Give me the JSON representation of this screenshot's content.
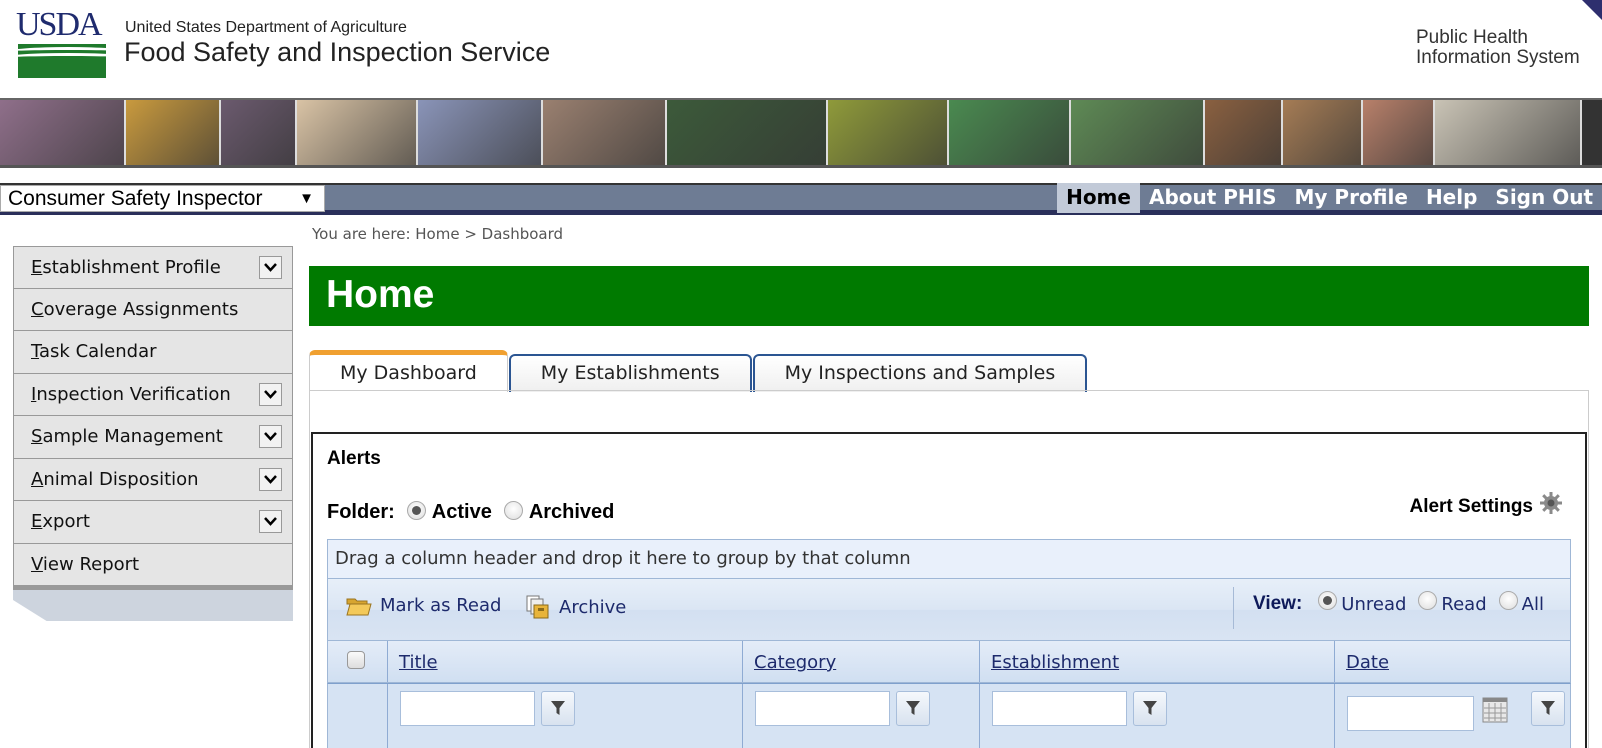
{
  "header": {
    "logo_text": "USDA",
    "agency_small": "United States Department of Agriculture",
    "agency_large": "Food Safety and Inspection Service",
    "system_name_line1": "Public Health",
    "system_name_line2": "Information System"
  },
  "photo_strip": {
    "photos": [
      {
        "subject": "lab-scientists",
        "color": "#8f6f8a"
      },
      {
        "subject": "chicks",
        "color": "#c99a3e"
      },
      {
        "subject": "poultry-processing",
        "color": "#6b5a6e"
      },
      {
        "subject": "pigs",
        "color": "#d9c3a5"
      },
      {
        "subject": "inspectors-lab",
        "color": "#8a94b8"
      },
      {
        "subject": "meat-processing-line",
        "color": "#9a8070"
      },
      {
        "subject": "cattle",
        "color": "#3c5a3a"
      },
      {
        "subject": "farmer-field",
        "color": "#8f9a3a"
      },
      {
        "subject": "microscope",
        "color": "#4a8a50"
      },
      {
        "subject": "crop-field",
        "color": "#5e8a55"
      },
      {
        "subject": "roast-poultry",
        "color": "#8a6040"
      },
      {
        "subject": "eggs",
        "color": "#a57c55"
      },
      {
        "subject": "food-worker",
        "color": "#b8806a"
      },
      {
        "subject": "cow-face",
        "color": "#c9c3b5"
      }
    ]
  },
  "navbar": {
    "role_select_value": "Consumer Safety Inspector",
    "links": [
      {
        "label": "Home",
        "active": true
      },
      {
        "label": "About PHIS",
        "active": false
      },
      {
        "label": "My Profile",
        "active": false
      },
      {
        "label": "Help",
        "active": false
      },
      {
        "label": "Sign Out",
        "active": false
      }
    ]
  },
  "sidebar": {
    "items": [
      {
        "accel": "E",
        "rest": "stablishment Profile",
        "expandable": true
      },
      {
        "accel": "C",
        "rest": "overage Assignments",
        "expandable": false
      },
      {
        "accel": "T",
        "rest": "ask Calendar",
        "expandable": false
      },
      {
        "accel": "I",
        "rest": "nspection Verification",
        "expandable": true
      },
      {
        "accel": "S",
        "rest": "ample Management",
        "expandable": true
      },
      {
        "accel": "A",
        "rest": "nimal Disposition",
        "expandable": true
      },
      {
        "accel": "E",
        "rest": "xport",
        "expandable": true
      },
      {
        "accel": "V",
        "rest": "iew Report",
        "expandable": false
      }
    ]
  },
  "breadcrumb": "You are here: Home > Dashboard",
  "page_title": "Home",
  "tabs": [
    {
      "label": "My Dashboard",
      "active": true
    },
    {
      "label": "My Establishments",
      "active": false
    },
    {
      "label": "My Inspections and Samples",
      "active": false
    }
  ],
  "alerts": {
    "title": "Alerts",
    "folder_label": "Folder:",
    "folder_options": [
      {
        "label": "Active",
        "checked": true
      },
      {
        "label": "Archived",
        "checked": false
      }
    ],
    "settings_label": "Alert Settings",
    "group_panel_text": "Drag a column header and drop it here to group by that column",
    "toolbar": {
      "mark_read_label": "Mark as Read",
      "archive_label": "Archive",
      "view_label": "View:",
      "view_options": [
        {
          "label": "Unread",
          "checked": true
        },
        {
          "label": "Read",
          "checked": false
        },
        {
          "label": "All",
          "checked": false
        }
      ]
    },
    "columns": [
      "Title",
      "Category",
      "Establishment",
      "Date"
    ],
    "filters": {
      "title_value": "",
      "category_value": "",
      "establishment_value": "",
      "date_value": ""
    }
  },
  "colors": {
    "title_bar_green": "#007a00",
    "nav_bar": "#6e7c94",
    "nav_bottom": "#2a2f5a",
    "active_tab_accent": "#f0a030",
    "grid_link": "#1d2a6c",
    "usda_blue": "#1f2b6e",
    "usda_green": "#1f7a2c"
  }
}
